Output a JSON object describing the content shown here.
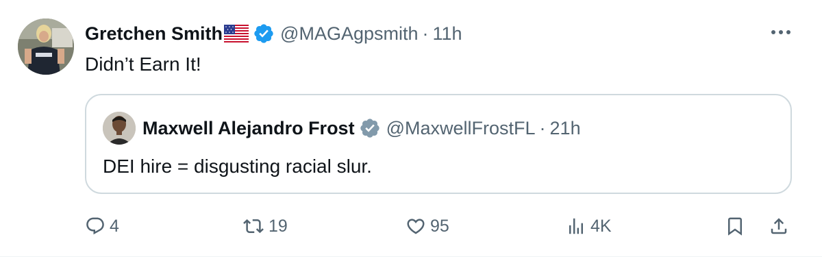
{
  "tweet": {
    "author_name": "Gretchen Smith",
    "author_flag": "us-flag-icon",
    "author_verified": true,
    "author_handle": "@MAGAgpsmith",
    "separator": "·",
    "time": "11h",
    "text": "Didn’t Earn It!"
  },
  "quoted_tweet": {
    "author_name": "Maxwell Alejandro Frost",
    "author_verified": true,
    "author_handle": "@MaxwellFrostFL",
    "separator": "·",
    "time": "21h",
    "text": "DEI hire = disgusting racial slur."
  },
  "actions": {
    "replies": "4",
    "reposts": "19",
    "likes": "95",
    "views": "4K"
  },
  "colors": {
    "verified_blue": "#1d9bf0",
    "verified_gray": "#829aab",
    "secondary_text": "#536471",
    "border": "#cfd9de"
  },
  "icons": {
    "more": "more-horizontal-icon",
    "reply": "reply-icon",
    "repost": "repost-icon",
    "like": "heart-icon",
    "views": "views-chart-icon",
    "bookmark": "bookmark-icon",
    "share": "share-icon"
  }
}
